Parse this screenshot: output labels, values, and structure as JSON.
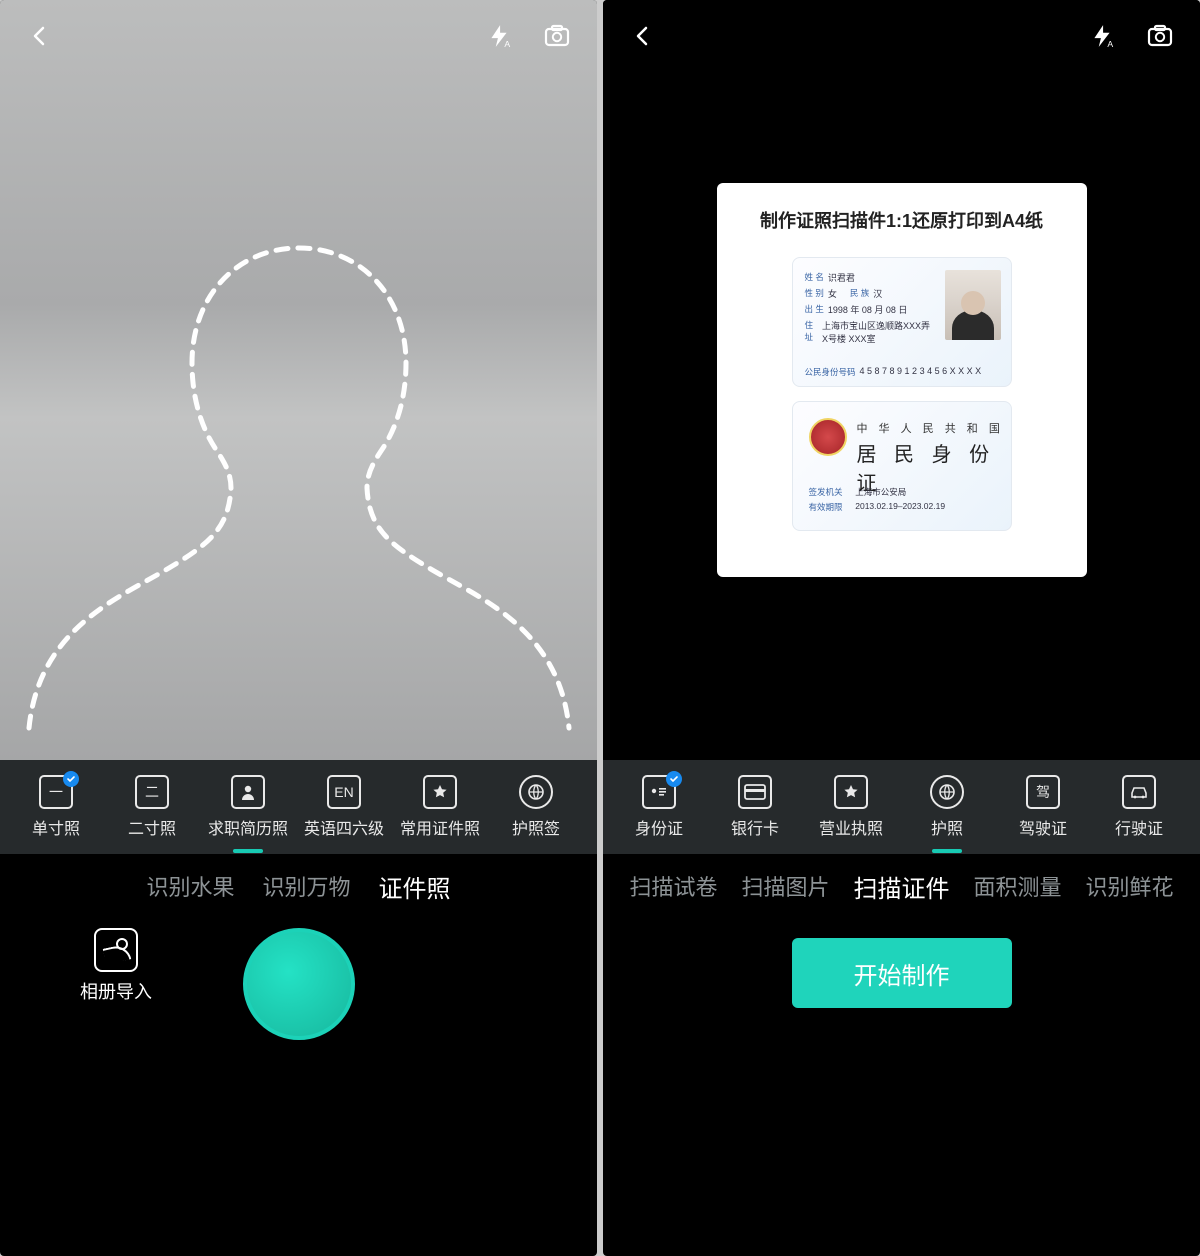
{
  "left": {
    "doc_types": [
      {
        "label": "单寸照",
        "icon": "一",
        "badge": true
      },
      {
        "label": "二寸照",
        "icon": "二"
      },
      {
        "label": "求职简历照",
        "icon": "person"
      },
      {
        "label": "英语四六级",
        "icon": "EN"
      },
      {
        "label": "常用证件照",
        "icon": "star"
      },
      {
        "label": "护照签",
        "icon": "globe"
      }
    ],
    "doc_type_selected_index": 2,
    "modes": [
      "识别水果",
      "识别万物",
      "证件照"
    ],
    "mode_active_index": 2,
    "gallery_label": "相册导入"
  },
  "right": {
    "panel_title": "制作证照扫描件1:1还原打印到A4纸",
    "id_front": {
      "name_label": "姓 名",
      "name_value": "识君君",
      "sex_label": "性 别",
      "sex_value": "女",
      "ethnic_label": "民 族",
      "ethnic_value": "汉",
      "birth_label": "出 生",
      "birth_value": "1998 年 08 月 08 日",
      "addr_label": "住 址",
      "addr_value": "上海市宝山区逸顺路XXX弄X号楼 XXX室",
      "num_label": "公民身份号码",
      "num_value": "4 5 8 7 8 9 1 2 3 4 5 6 X X X X"
    },
    "id_back": {
      "country": "中 华 人 民 共 和 国",
      "doc": "居 民 身 份 证",
      "issuer_label": "签发机关",
      "issuer_value": "上海市公安局",
      "valid_label": "有效期限",
      "valid_value": "2013.02.19–2023.02.19"
    },
    "doc_types": [
      {
        "label": "身份证",
        "icon": "id",
        "badge": true
      },
      {
        "label": "银行卡",
        "icon": "card"
      },
      {
        "label": "营业执照",
        "icon": "star"
      },
      {
        "label": "护照",
        "icon": "globe"
      },
      {
        "label": "驾驶证",
        "icon": "驾"
      },
      {
        "label": "行驶证",
        "icon": "car"
      }
    ],
    "doc_type_selected_index": 3,
    "modes": [
      "扫描试卷",
      "扫描图片",
      "扫描证件",
      "面积测量",
      "识别鲜花"
    ],
    "mode_active_index": 2,
    "start_label": "开始制作"
  }
}
